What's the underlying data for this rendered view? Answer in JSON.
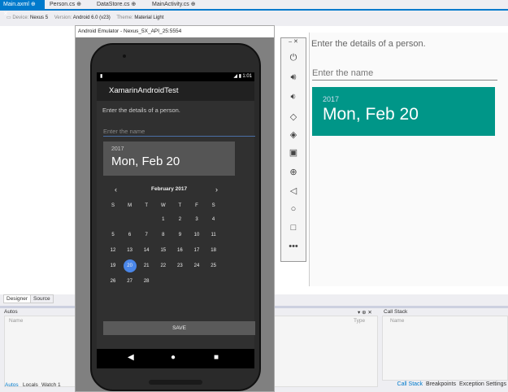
{
  "tabs": [
    {
      "label": "Main.axml",
      "active": true
    },
    {
      "label": "Person.cs"
    },
    {
      "label": "DataStore.cs"
    },
    {
      "label": "MainActivity.cs"
    }
  ],
  "toolbar": {
    "device_label": "Device:",
    "device": "Nexus 5",
    "version_label": "Version:",
    "version": "Android 6.0 (v23)",
    "theme_label": "Theme:",
    "theme": "Material Light"
  },
  "preview": {
    "prompt": "Enter the details of a person.",
    "name_placeholder": "Enter the name",
    "year": "2017",
    "date": "Mon, Feb 20",
    "accent": "#009688"
  },
  "emulator": {
    "title": "Android Emulator - Nexus_5X_API_25:5554",
    "clock": "1:01",
    "app_title": "XamarinAndroidTest",
    "prompt": "Enter the details of a person.",
    "name_placeholder": "Enter the name",
    "year": "2017",
    "date": "Mon, Feb 20",
    "month": "February 2017",
    "weekdays": [
      "S",
      "M",
      "T",
      "W",
      "T",
      "F",
      "S"
    ],
    "days": [
      "1",
      "2",
      "3",
      "4",
      "5",
      "6",
      "7",
      "8",
      "9",
      "10",
      "11",
      "12",
      "13",
      "14",
      "15",
      "16",
      "17",
      "18",
      "19",
      "20",
      "21",
      "22",
      "23",
      "24",
      "25",
      "26",
      "27",
      "28"
    ],
    "first_weekday": 3,
    "selected_day": "20",
    "save": "SAVE"
  },
  "bottom": {
    "designer_tabs": [
      "Designer",
      "Source"
    ],
    "autos_title": "Autos",
    "col_name": "Name",
    "col_type": "Type",
    "autos_tabs": [
      "Autos",
      "Locals",
      "Watch 1"
    ],
    "callstack_title": "Call Stack",
    "cs_col_name": "Name",
    "cs_tabs": [
      "Call Stack",
      "Breakpoints",
      "Exception Settings"
    ]
  }
}
